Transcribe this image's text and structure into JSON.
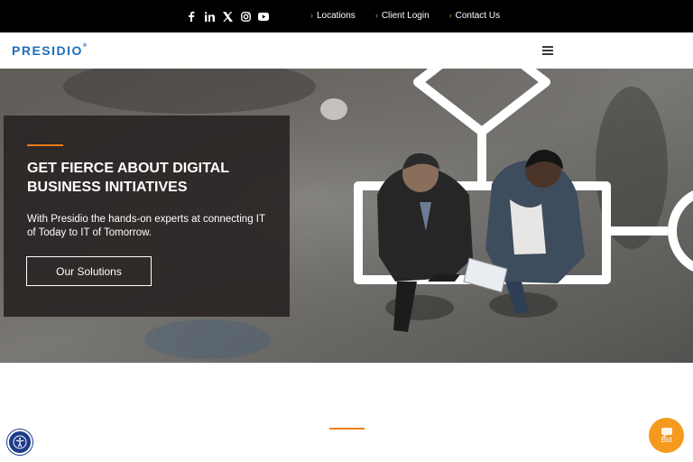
{
  "topbar": {
    "social": [
      "facebook-icon",
      "linkedin-icon",
      "x-icon",
      "instagram-icon",
      "youtube-icon"
    ],
    "links": [
      {
        "label": "Locations"
      },
      {
        "label": "Client Login"
      },
      {
        "label": "Contact Us"
      }
    ]
  },
  "nav": {
    "logo": "PRESIDIO",
    "logo_mark": "®"
  },
  "hero": {
    "headline": "GET FIERCE ABOUT DIGITAL BUSINESS INITIATIVES",
    "body": "With Presidio the hands-on experts at connecting IT of Today to IT of Tomorrow.",
    "cta": "Our Solutions"
  },
  "chat": {
    "label": "Bld"
  },
  "colors": {
    "accent": "#f07d1a",
    "brand": "#1e6fb8",
    "topbar": "#000000",
    "chat": "#f59a1e"
  }
}
